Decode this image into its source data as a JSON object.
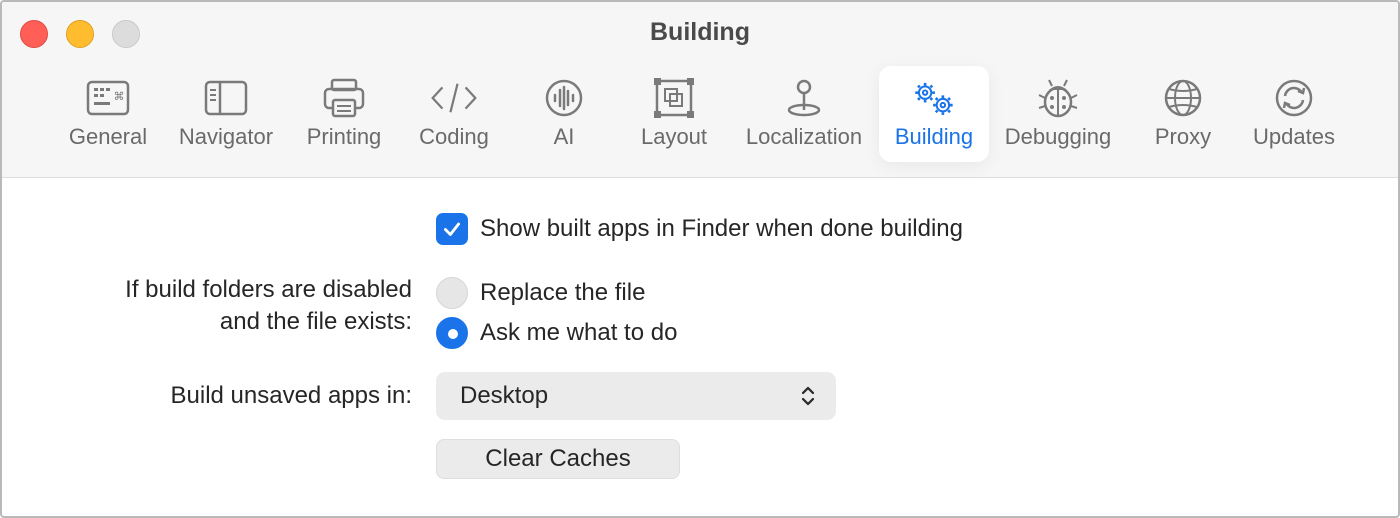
{
  "window": {
    "title": "Building"
  },
  "tabs": [
    {
      "id": "general",
      "label": "General",
      "icon": "keyboard-icon"
    },
    {
      "id": "navigator",
      "label": "Navigator",
      "icon": "sidebar-icon"
    },
    {
      "id": "printing",
      "label": "Printing",
      "icon": "printer-icon"
    },
    {
      "id": "coding",
      "label": "Coding",
      "icon": "code-brackets-icon"
    },
    {
      "id": "ai",
      "label": "AI",
      "icon": "waveform-icon"
    },
    {
      "id": "layout",
      "label": "Layout",
      "icon": "layout-frame-icon"
    },
    {
      "id": "localization",
      "label": "Localization",
      "icon": "map-pin-icon"
    },
    {
      "id": "building",
      "label": "Building",
      "icon": "gears-icon",
      "selected": true
    },
    {
      "id": "debugging",
      "label": "Debugging",
      "icon": "ladybug-icon"
    },
    {
      "id": "proxy",
      "label": "Proxy",
      "icon": "globe-icon"
    },
    {
      "id": "updates",
      "label": "Updates",
      "icon": "refresh-icon"
    }
  ],
  "building": {
    "show_in_finder": {
      "label": "Show built apps in Finder when done building",
      "checked": true
    },
    "conflict": {
      "label_line1": "If build folders are disabled",
      "label_line2": "and the file exists:",
      "options": [
        {
          "label": "Replace the file",
          "selected": false
        },
        {
          "label": "Ask me what to do",
          "selected": true
        }
      ]
    },
    "unsaved": {
      "label": "Build unsaved apps in:",
      "value": "Desktop"
    },
    "clear_caches": {
      "label": "Clear Caches"
    }
  },
  "colors": {
    "accent": "#1a73e8",
    "close": "#ff5f57",
    "minimize": "#febc2e",
    "zoom": "#dcdcdc"
  }
}
